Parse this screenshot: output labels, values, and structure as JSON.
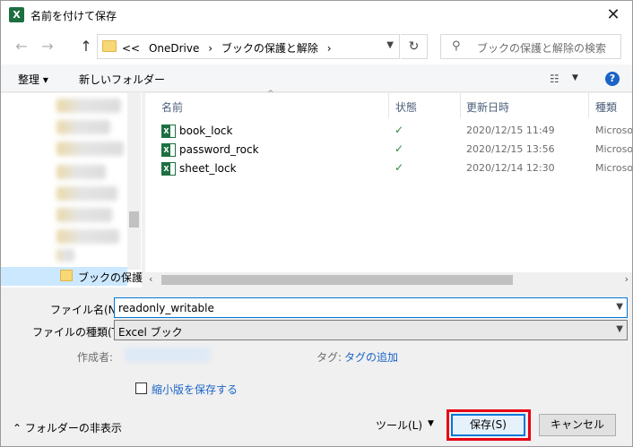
{
  "window": {
    "title": "名前を付けて保存",
    "app_icon": "X",
    "close": "✕"
  },
  "nav": {
    "back": "←",
    "forward": "→",
    "up": "↑",
    "breadcrumb": [
      "<<",
      "OneDrive",
      "›",
      "ブックの保護と解除",
      "›"
    ],
    "refresh": "↻",
    "search_placeholder": "ブックの保護と解除の検索"
  },
  "toolbar": {
    "organize": "整理 ▾",
    "new_folder": "新しいフォルダー",
    "help": "?"
  },
  "navpane": {
    "selected_folder": "ブックの保護"
  },
  "filelist": {
    "columns": {
      "name": "名前",
      "status": "状態",
      "modified": "更新日時",
      "type": "種類"
    },
    "files": [
      {
        "name": "book_lock",
        "status": "✓",
        "modified": "2020/12/15 11:49",
        "type": "Microsoft"
      },
      {
        "name": "password_rock",
        "status": "✓",
        "modified": "2020/12/15 13:56",
        "type": "Microsoft"
      },
      {
        "name": "sheet_lock",
        "status": "✓",
        "modified": "2020/12/14 12:30",
        "type": "Microsoft"
      }
    ]
  },
  "form": {
    "filename_label": "ファイル名(N):",
    "filename_value": "readonly_writable",
    "filetype_label": "ファイルの種類(T):",
    "filetype_value": "Excel ブック",
    "author_label": "作成者:",
    "tags_label": "タグ:",
    "tags_link": "タグの追加",
    "thumbnail_label": "縮小版を保存する"
  },
  "footer": {
    "hide_folders": "フォルダーの非表示",
    "tools": "ツール(L)",
    "save": "保存(S)",
    "cancel": "キャンセル"
  },
  "colors": {
    "accent": "#0078d7",
    "highlight_outline": "#e60012",
    "excel_green": "#1d6f42",
    "link": "#1c63c8"
  }
}
